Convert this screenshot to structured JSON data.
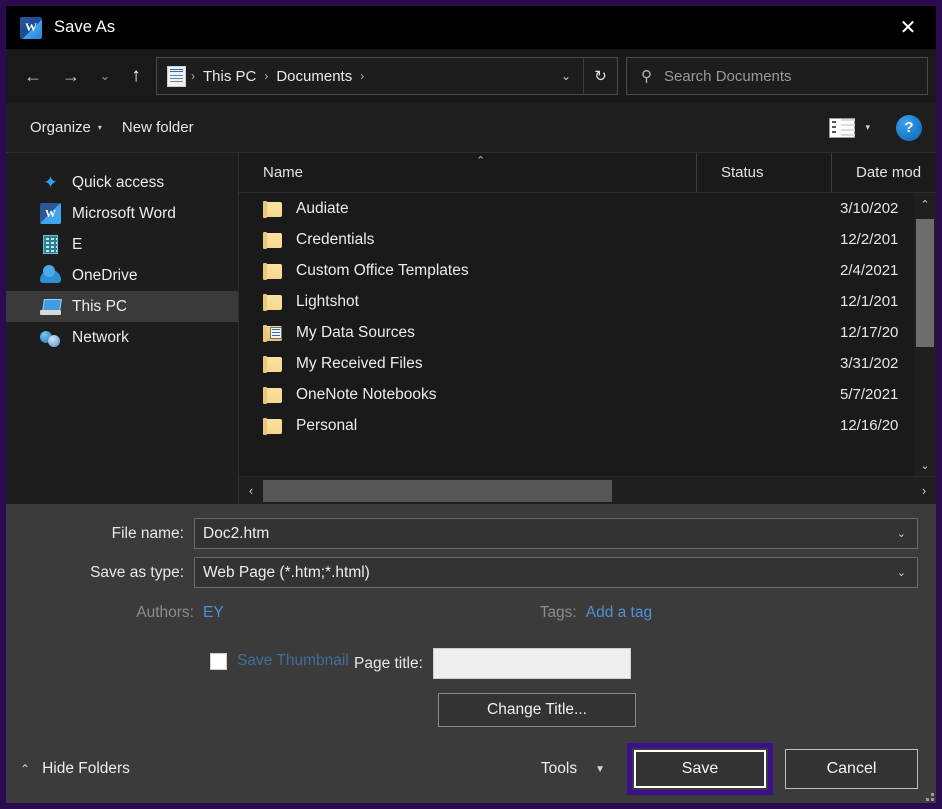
{
  "window": {
    "title": "Save As",
    "app_icon": "word-icon",
    "close_label": "✕",
    "accent_border": "#2b0a4d",
    "highlight_color": "#3d0f8f"
  },
  "addressbar": {
    "back": "←",
    "forward": "→",
    "recent": "⌄",
    "up": "↑",
    "breadcrumbs": [
      "This PC",
      "Documents"
    ],
    "separator": "›",
    "dropdown": "⌄",
    "refresh": "↻"
  },
  "search": {
    "placeholder": "Search Documents",
    "icon": "search-icon"
  },
  "commandbar": {
    "organize": "Organize",
    "new_folder": "New folder",
    "caret": "▾",
    "view_caret": "▾",
    "help": "?"
  },
  "sidebar": {
    "items": [
      {
        "label": "Quick access",
        "icon": "star-icon",
        "selected": false
      },
      {
        "label": "Microsoft Word",
        "icon": "word-icon",
        "selected": false
      },
      {
        "label": "E",
        "icon": "building-icon",
        "selected": false
      },
      {
        "label": "OneDrive",
        "icon": "cloud-icon",
        "selected": false
      },
      {
        "label": "This PC",
        "icon": "computer-icon",
        "selected": true
      },
      {
        "label": "Network",
        "icon": "network-icon",
        "selected": false
      }
    ]
  },
  "filelist": {
    "columns": [
      "Name",
      "Status",
      "Date modified"
    ],
    "column_date_truncated": "Date mod",
    "sort_indicator": "⌃",
    "rows": [
      {
        "name": "Audiate",
        "status": "",
        "date": "3/10/202",
        "icon": "folder-icon"
      },
      {
        "name": "Credentials",
        "status": "",
        "date": "12/2/201",
        "icon": "folder-icon"
      },
      {
        "name": "Custom Office Templates",
        "status": "",
        "date": "2/4/2021",
        "icon": "folder-icon"
      },
      {
        "name": "Lightshot",
        "status": "",
        "date": "12/1/201",
        "icon": "folder-icon"
      },
      {
        "name": "My Data Sources",
        "status": "",
        "date": "12/17/20",
        "icon": "folder-special-icon"
      },
      {
        "name": "My Received Files",
        "status": "",
        "date": "3/31/202",
        "icon": "folder-icon"
      },
      {
        "name": "OneNote Notebooks",
        "status": "",
        "date": "5/7/2021",
        "icon": "folder-icon"
      },
      {
        "name": "Personal",
        "status": "",
        "date": "12/16/20",
        "icon": "folder-icon"
      }
    ],
    "scroll_up": "⌃",
    "scroll_down": "⌄",
    "scroll_left": "‹",
    "scroll_right": "›"
  },
  "form": {
    "file_name_label": "File name:",
    "file_name_value": "Doc2.htm",
    "save_as_type_label": "Save as type:",
    "save_as_type_value": "Web Page (*.htm;*.html)",
    "dropdown_caret": "⌄",
    "authors_label": "Authors:",
    "authors_value": "EY",
    "tags_label": "Tags:",
    "tags_value": "Add a tag",
    "save_thumbnail_label": "Save Thumbnail",
    "save_thumbnail_checked": false,
    "page_title_label": "Page title:",
    "page_title_value": "",
    "change_title_label": "Change Title..."
  },
  "footer": {
    "hide_folders_label": "Hide Folders",
    "hide_folders_caret": "⌃",
    "tools_label": "Tools",
    "tools_caret": "▼",
    "save_label": "Save",
    "cancel_label": "Cancel"
  }
}
